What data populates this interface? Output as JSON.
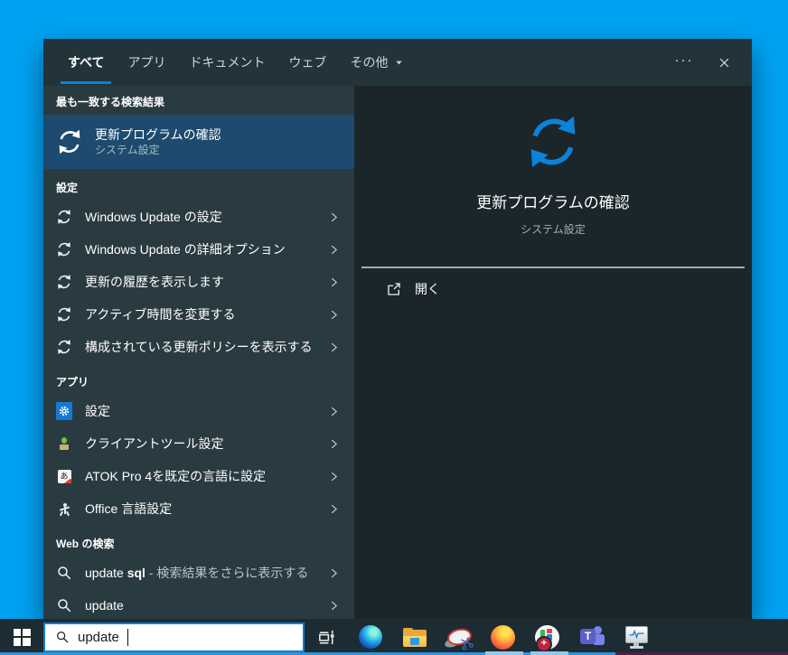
{
  "tabs": {
    "items": [
      {
        "label": "すべて"
      },
      {
        "label": "アプリ"
      },
      {
        "label": "ドキュメント"
      },
      {
        "label": "ウェブ"
      },
      {
        "label": "その他"
      }
    ],
    "ellipsis": "···"
  },
  "left": {
    "best_match_header": "最も一致する検索結果",
    "best_match": {
      "title": "更新プログラムの確認",
      "subtitle": "システム設定"
    },
    "settings_header": "設定",
    "settings": [
      {
        "label": "Windows Update の設定"
      },
      {
        "label": "Windows Update の詳細オプション"
      },
      {
        "label": "更新の履歴を表示します"
      },
      {
        "label": "アクティブ時間を変更する"
      },
      {
        "label": "構成されている更新ポリシーを表示する"
      }
    ],
    "apps_header": "アプリ",
    "apps": [
      {
        "label": "設定"
      },
      {
        "label": "クライアントツール設定"
      },
      {
        "label": "ATOK Pro 4を既定の言語に設定"
      },
      {
        "label": "Office 言語設定"
      }
    ],
    "web_header": "Web の検索",
    "web": [
      {
        "prefix": "update ",
        "bold": "sql",
        "suffix": " - 検索結果をさらに表示する"
      },
      {
        "prefix": "update",
        "bold": "",
        "suffix": ""
      }
    ]
  },
  "preview": {
    "title": "更新プログラムの確認",
    "subtitle": "システム設定",
    "action": "開く"
  },
  "taskbar": {
    "search_value": "update",
    "icons": [
      "edge",
      "file-explorer",
      "snipping-tool",
      "firefox",
      "badge-app",
      "teams",
      "system-monitor"
    ],
    "teams_t": "T",
    "badge_plus": "+",
    "atok_glyph": "あ"
  },
  "colors": {
    "desktop": "#00a2f2",
    "accent": "#0f80d7",
    "best_match_highlight": "#1d4a6e",
    "panel_left": "#2a3a41",
    "panel_right": "#1b262b",
    "taskbar": "#1d2b32"
  }
}
